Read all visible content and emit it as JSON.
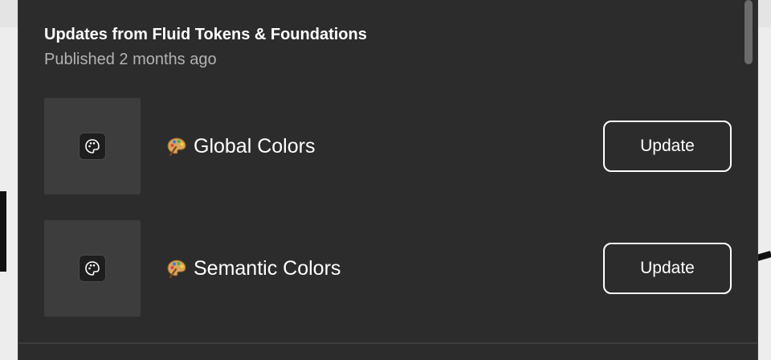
{
  "panel": {
    "title": "Updates from Fluid Tokens & Foundations",
    "subtitle": "Published 2 months ago"
  },
  "libraries": [
    {
      "name": "Global Colors",
      "icon": "palette-emoji",
      "thumbnail_icon": "palette-icon",
      "action_label": "Update"
    },
    {
      "name": "Semantic Colors",
      "icon": "palette-emoji",
      "thumbnail_icon": "palette-icon",
      "action_label": "Update"
    }
  ],
  "colors": {
    "panel_bg": "#2c2c2c",
    "thumb_bg": "#3d3d3d",
    "text_primary": "#ffffff",
    "text_secondary": "#b3b3b3"
  }
}
